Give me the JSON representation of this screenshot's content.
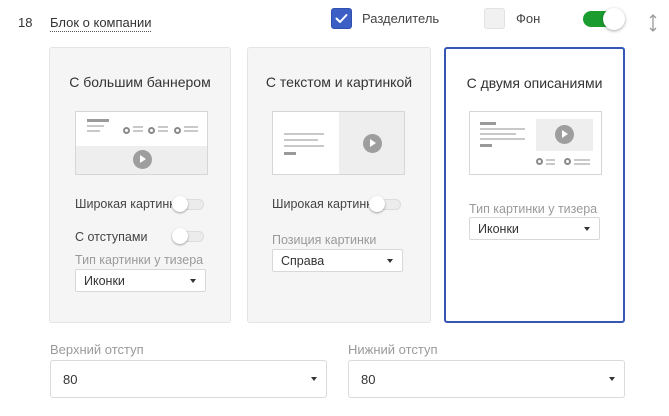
{
  "block": {
    "number": "18",
    "title": "Блок о компании"
  },
  "controls": {
    "divider": {
      "label": "Разделитель",
      "checked": true
    },
    "background": {
      "label": "Фон",
      "checked": false
    },
    "enabled": true
  },
  "layouts": [
    {
      "title": "С большим баннером",
      "selected": false,
      "options": {
        "wide_image_label": "Широкая картинка",
        "indent_label": "С отступами",
        "teaser_type_label": "Тип картинки у тизера",
        "teaser_type_value": "Иконки"
      }
    },
    {
      "title": "С текстом и картинкой",
      "selected": false,
      "options": {
        "wide_image_label": "Широкая картинка",
        "position_label": "Позиция картинки",
        "position_value": "Справа"
      }
    },
    {
      "title": "С двумя описаниями",
      "selected": true,
      "options": {
        "teaser_type_label": "Тип картинки у тизера",
        "teaser_type_value": "Иконки"
      }
    }
  ],
  "spacing": {
    "top": {
      "label": "Верхний отступ",
      "value": "80"
    },
    "bottom": {
      "label": "Нижний отступ",
      "value": "80"
    }
  },
  "colors": {
    "accent": "#3b5fc4",
    "toggle_on": "#1a9c2e",
    "selected_border": "#3656b5"
  }
}
